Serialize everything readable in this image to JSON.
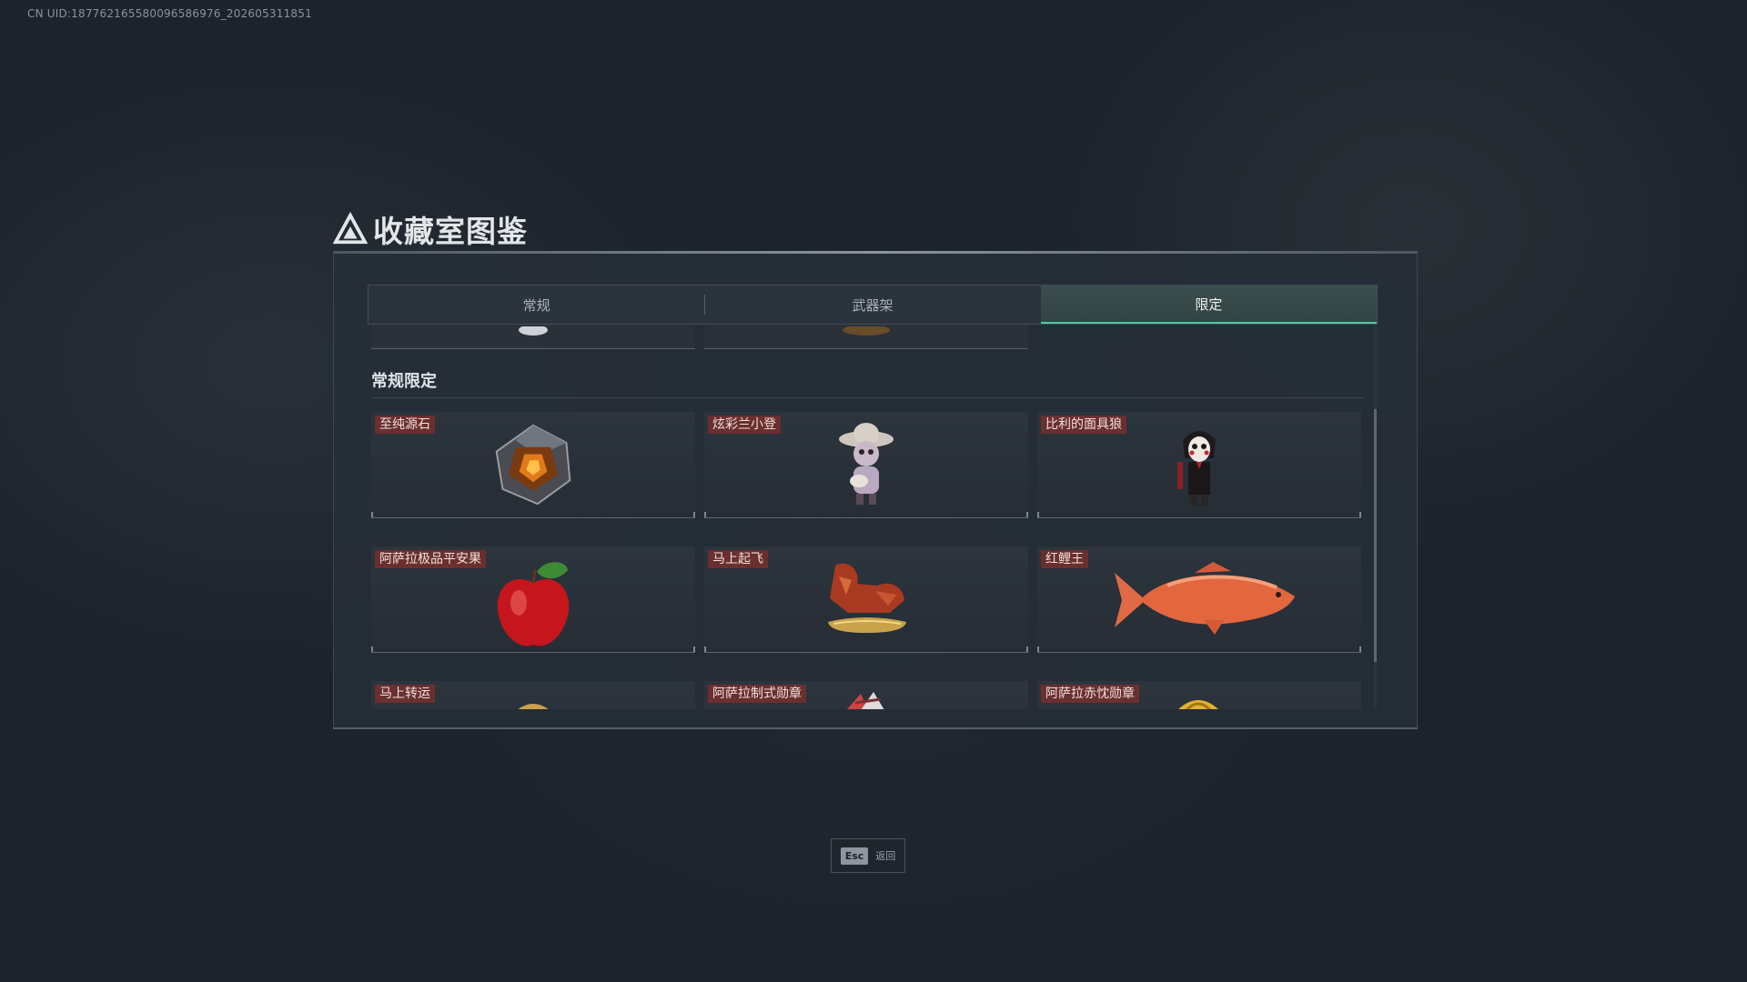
{
  "uid_text": "CN UID:187762165580096586976_202605311851",
  "title": "收藏室图鉴",
  "tabs": [
    {
      "label": "常规",
      "active": false
    },
    {
      "label": "武器架",
      "active": false
    },
    {
      "label": "限定",
      "active": true
    }
  ],
  "section": {
    "title": "常规限定",
    "items": [
      {
        "label": "至纯源石",
        "icon": "crystal-icon"
      },
      {
        "label": "炫彩兰小登",
        "icon": "figurine-icon"
      },
      {
        "label": "比利的面具狼",
        "icon": "puppet-icon"
      },
      {
        "label": "阿萨拉极品平安果",
        "icon": "apple-icon"
      },
      {
        "label": "马上起飞",
        "icon": "horse-icon"
      },
      {
        "label": "红鲤王",
        "icon": "carp-icon"
      },
      {
        "label": "马上转运",
        "icon": "gold-horse-icon"
      },
      {
        "label": "阿萨拉制式勋章",
        "icon": "medal-icon"
      },
      {
        "label": "阿萨拉赤忱勋章",
        "icon": "gold-medal-icon"
      }
    ]
  },
  "footer": {
    "esc_key": "Esc",
    "esc_label": "返回"
  },
  "colors": {
    "accent": "#4fc9a3",
    "label_bg": "#6a2f2f",
    "panel_bg": "#262e37"
  }
}
